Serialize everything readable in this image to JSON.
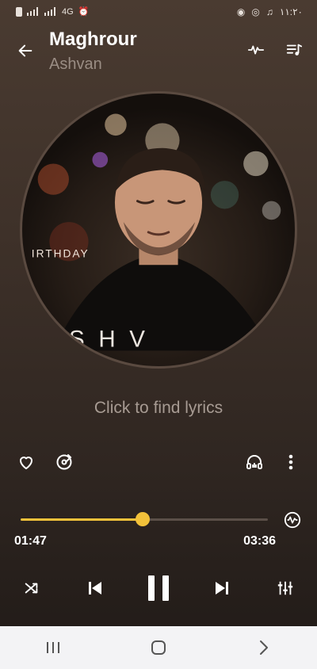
{
  "status_bar": {
    "network": "4G",
    "time": "۱۱:۲۰"
  },
  "header": {
    "title": "Maghrour",
    "artist": "Ashvan"
  },
  "lyrics": {
    "link_text": "Click to find lyrics"
  },
  "album_art": {
    "printed_text_top": "IRTHDAY",
    "printed_text_bottom": "SHV"
  },
  "player": {
    "progress_fraction": 0.495,
    "current_time": "01:47",
    "total_time": "03:36",
    "accent_color": "#f2c13a"
  },
  "icons": {
    "back": "back-arrow-icon",
    "waveform": "waveform-icon",
    "queue": "playlist-icon",
    "favorite": "heart-icon",
    "disc": "disc-edit-icon",
    "headphones": "headphones-icon",
    "more": "more-vertical-icon",
    "visualizer": "visualizer-icon",
    "shuffle": "shuffle-icon",
    "previous": "skip-previous-icon",
    "pause": "pause-icon",
    "next": "skip-next-icon",
    "equalizer": "equalizer-icon"
  }
}
